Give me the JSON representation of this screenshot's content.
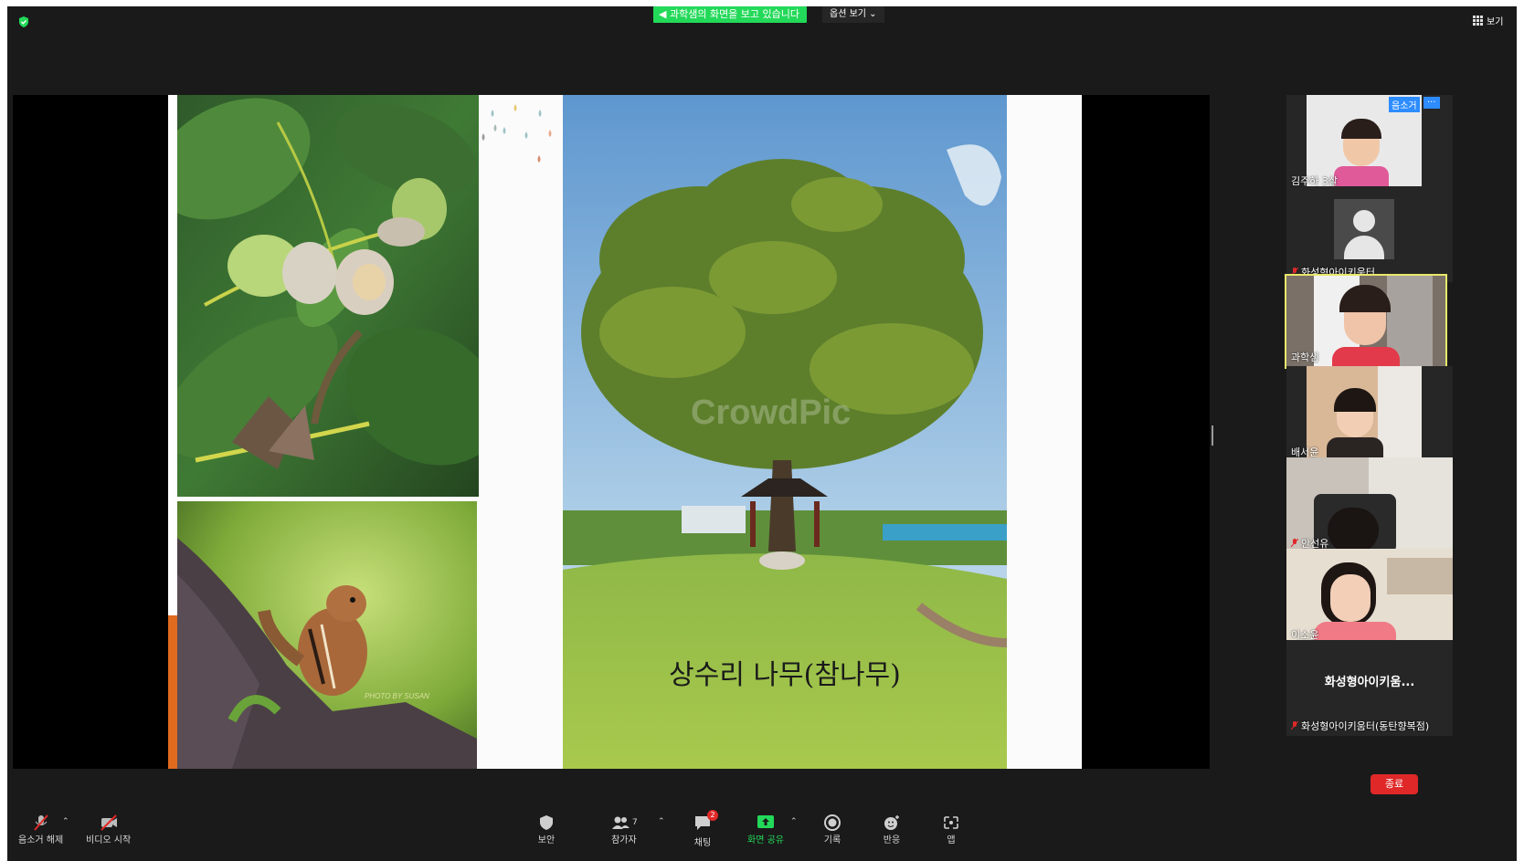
{
  "banner": {
    "text": "과학샘의 화면을 보고 있습니다",
    "view_options": "옵션 보기"
  },
  "top_right": {
    "view_label": "보기"
  },
  "slide": {
    "caption": "상수리 나무(참나무)",
    "watermark": "CrowdPic",
    "photo_credit": "PHOTO BY SUSAN"
  },
  "participants": [
    {
      "name": "김주하 3살",
      "tag": "음소거",
      "more": "···"
    },
    {
      "name": "화성형아이키움터"
    },
    {
      "name": "과학샘"
    },
    {
      "name": "배서윤"
    },
    {
      "name": "안선유"
    },
    {
      "name": "이소윤"
    },
    {
      "name": "화성형아이키움터(동탄향복점)",
      "title": "화성형아이키움..."
    }
  ],
  "toolbar": {
    "unmute": "음소거 해제",
    "start_video": "비디오 시작",
    "security": "보안",
    "participants": "참가자",
    "participants_count": "7",
    "chat": "채팅",
    "chat_badge": "2",
    "share_screen": "화면 공유",
    "record": "기록",
    "reactions": "반응",
    "apps": "앱",
    "end": "종료"
  },
  "colors": {
    "banner_green": "#23d959",
    "end_red": "#e02828",
    "active_speaker": "#e8e86a"
  }
}
